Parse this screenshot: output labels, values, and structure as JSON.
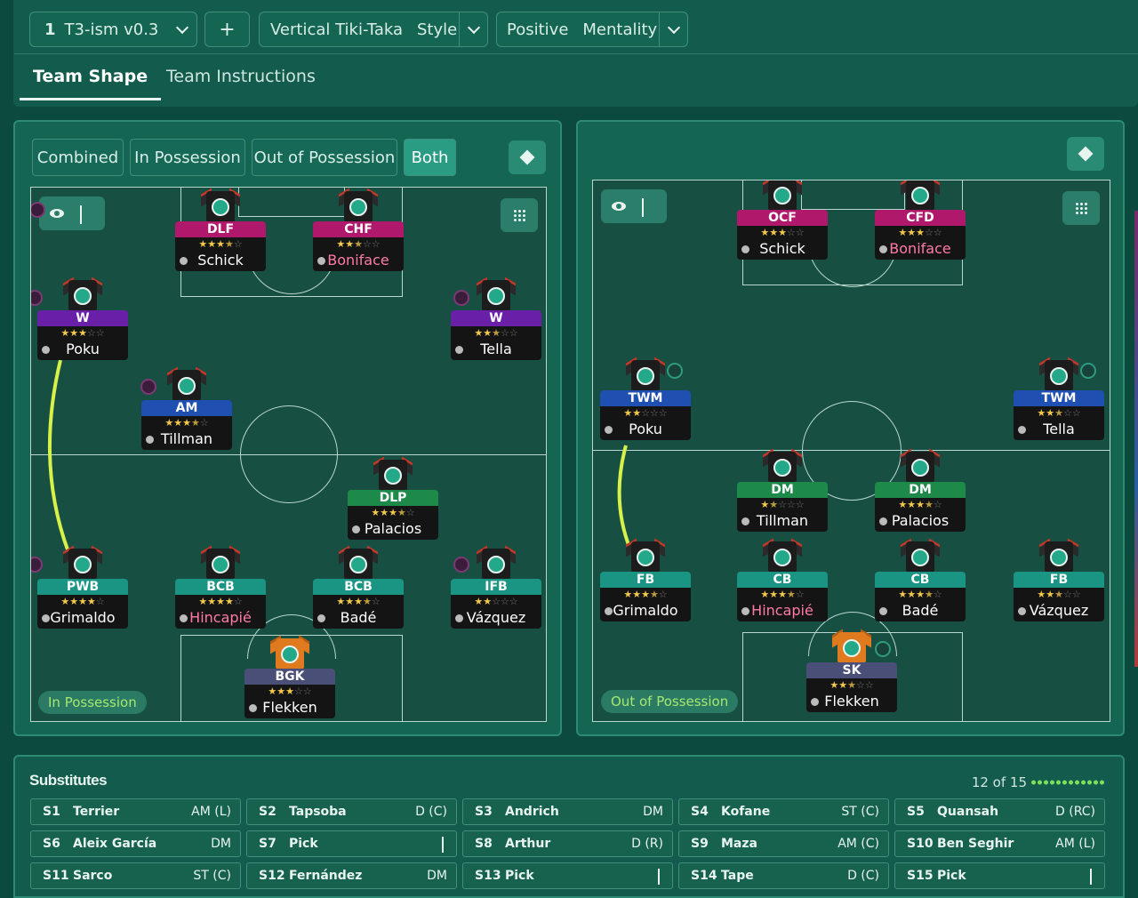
{
  "header": {
    "tactic_index": "1",
    "tactic_name": "T3-ism v0.3",
    "add_label": "+",
    "style_value": "Vertical Tiki-Taka",
    "style_label": "Style",
    "mentality_value": "Positive",
    "mentality_label": "Mentality"
  },
  "tabs": [
    "Team Shape",
    "Team Instructions"
  ],
  "filters": [
    "Combined",
    "In Possession",
    "Out of Possession",
    "Both"
  ],
  "left_phase": "In Possession",
  "right_phase": "Out of Possession",
  "left_players": [
    {
      "role": "DLF",
      "stars": 3.5,
      "name": "Schick",
      "color": "#b0186c",
      "red": false
    },
    {
      "role": "CHF",
      "stars": 2.5,
      "name": "Boniface",
      "color": "#b0186c",
      "red": true
    },
    {
      "role": "W",
      "stars": 3,
      "name": "Poku",
      "color": "#6a1fa8",
      "red": false
    },
    {
      "role": "W",
      "stars": 2.5,
      "name": "Tella",
      "color": "#6a1fa8",
      "red": false
    },
    {
      "role": "AM",
      "stars": 3.5,
      "name": "Tillman",
      "color": "#1f4fb0",
      "red": false
    },
    {
      "role": "DLP",
      "stars": 3.5,
      "name": "Palacios",
      "color": "#1e8a4a",
      "red": false
    },
    {
      "role": "PWB",
      "stars": 4,
      "name": "Grimaldo",
      "color": "#1a9483",
      "red": false
    },
    {
      "role": "BCB",
      "stars": 4,
      "name": "Hincapié",
      "color": "#1a9483",
      "red": true
    },
    {
      "role": "BCB",
      "stars": 3.5,
      "name": "Badé",
      "color": "#1a9483",
      "red": false
    },
    {
      "role": "IFB",
      "stars": 2,
      "name": "Vázquez",
      "color": "#1a9483",
      "red": false
    },
    {
      "role": "BGK",
      "stars": 3,
      "name": "Flekken",
      "color": "#4a4f78",
      "red": false
    }
  ],
  "right_players": [
    {
      "role": "OCF",
      "stars": 3,
      "name": "Schick",
      "color": "#b0186c",
      "red": false
    },
    {
      "role": "CFD",
      "stars": 3,
      "name": "Boniface",
      "color": "#b0186c",
      "red": true
    },
    {
      "role": "TWM",
      "stars": 2,
      "name": "Poku",
      "color": "#1f4fb0",
      "red": false
    },
    {
      "role": "TWM",
      "stars": 2.5,
      "name": "Tella",
      "color": "#1f4fb0",
      "red": false
    },
    {
      "role": "DM",
      "stars": 1.5,
      "name": "Tillman",
      "color": "#1e8a4a",
      "red": false
    },
    {
      "role": "DM",
      "stars": 3.5,
      "name": "Palacios",
      "color": "#1e8a4a",
      "red": false
    },
    {
      "role": "FB",
      "stars": 3.5,
      "name": "Grimaldo",
      "color": "#1a9483",
      "red": false
    },
    {
      "role": "CB",
      "stars": 3.5,
      "name": "Hincapié",
      "color": "#1a9483",
      "red": true
    },
    {
      "role": "CB",
      "stars": 3.5,
      "name": "Badé",
      "color": "#1a9483",
      "red": false
    },
    {
      "role": "FB",
      "stars": 2.5,
      "name": "Vázquez",
      "color": "#1a9483",
      "red": false
    },
    {
      "role": "SK",
      "stars": 2.5,
      "name": "Flekken",
      "color": "#4a4f78",
      "red": false
    }
  ],
  "subs_title": "Substitutes",
  "subs_count": "12 of 15",
  "subs": [
    {
      "slot": "S1",
      "name": "Terrier",
      "pos": "AM (L)"
    },
    {
      "slot": "S2",
      "name": "Tapsoba",
      "pos": "D (C)"
    },
    {
      "slot": "S3",
      "name": "Andrich",
      "pos": "DM"
    },
    {
      "slot": "S4",
      "name": "Kofane",
      "pos": "ST (C)"
    },
    {
      "slot": "S5",
      "name": "Quansah",
      "pos": "D (RC)"
    },
    {
      "slot": "S6",
      "name": "Aleix García",
      "pos": "DM"
    },
    {
      "slot": "S7",
      "name": "Pick",
      "pos": ""
    },
    {
      "slot": "S8",
      "name": "Arthur",
      "pos": "D (R)"
    },
    {
      "slot": "S9",
      "name": "Maza",
      "pos": "AM (C)"
    },
    {
      "slot": "S10",
      "name": "Ben Seghir",
      "pos": "AM (L)"
    },
    {
      "slot": "S11",
      "name": "Sarco",
      "pos": "ST (C)"
    },
    {
      "slot": "S12",
      "name": "Fernández",
      "pos": "DM"
    },
    {
      "slot": "S13",
      "name": "Pick",
      "pos": ""
    },
    {
      "slot": "S14",
      "name": "Tape",
      "pos": "D (C)"
    },
    {
      "slot": "S15",
      "name": "Pick",
      "pos": ""
    }
  ],
  "icons": {
    "diamond": "diamond-icon",
    "eye": "eye-icon",
    "grid": "grid-icon",
    "chevron": "chevron-down-icon"
  }
}
